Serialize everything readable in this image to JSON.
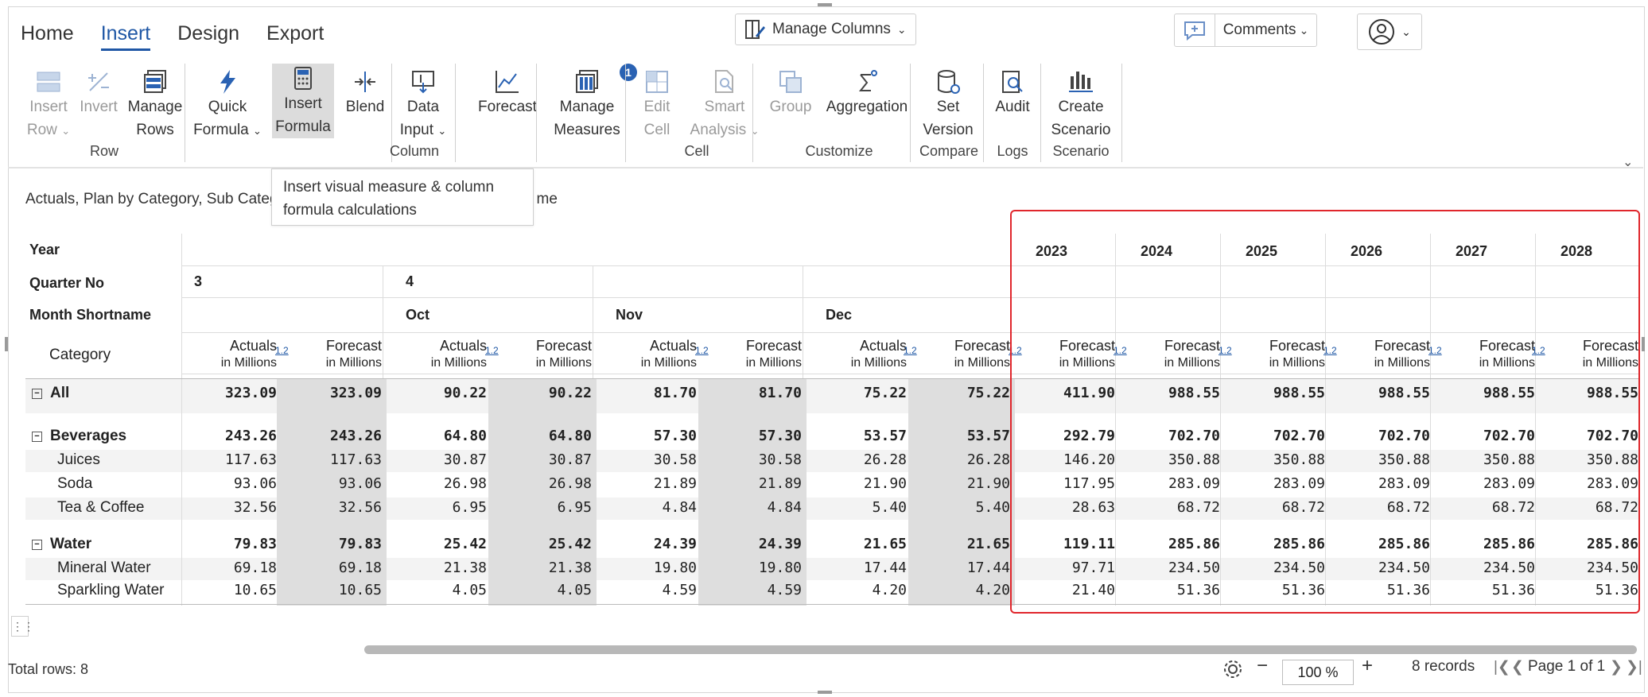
{
  "tabs": [
    {
      "label": "Home",
      "active": false
    },
    {
      "label": "Insert",
      "active": true
    },
    {
      "label": "Design",
      "active": false
    },
    {
      "label": "Export",
      "active": false
    }
  ],
  "manage_columns": {
    "label": "Manage Columns"
  },
  "comments": {
    "label": "Comments"
  },
  "ribbon": {
    "insert_row": [
      "Insert",
      "Row"
    ],
    "invert": "Invert",
    "manage_rows": [
      "Manage",
      "Rows"
    ],
    "quick_formula": [
      "Quick",
      "Formula"
    ],
    "insert_formula": [
      "Insert",
      "Formula"
    ],
    "blend": "Blend",
    "data_input": [
      "Data",
      "Input"
    ],
    "forecast": "Forecast",
    "manage_measures": [
      "Manage",
      "Measures"
    ],
    "manage_measures_badge": "1",
    "edit_cell": [
      "Edit",
      "Cell"
    ],
    "smart_analysis": [
      "Smart",
      "Analysis"
    ],
    "group": "Group",
    "aggregation": "Aggregation",
    "set_version": [
      "Set",
      "Version"
    ],
    "audit": "Audit",
    "create_scenario": [
      "Create",
      "Scenario"
    ],
    "groups": [
      "Row",
      "Column",
      "Cell",
      "Customize",
      "Compare",
      "Logs",
      "Scenario"
    ]
  },
  "tooltip": [
    "Insert visual measure & column",
    "formula calculations"
  ],
  "subtitle": {
    "left": "Actuals, Plan by Category, Sub Categ",
    "right": "me"
  },
  "grid": {
    "labels": {
      "year": "Year",
      "quarter": "Quarter No",
      "month": "Month Shortname",
      "category": "Category"
    },
    "quarter_values": [
      "3",
      "4"
    ],
    "months": [
      "Oct",
      "Nov",
      "Dec"
    ],
    "years": [
      "2023",
      "2024",
      "2025",
      "2026",
      "2027",
      "2028"
    ],
    "measure_actuals": "Actuals",
    "measure_forecast": "Forecast",
    "measure_unit": "in Millions",
    "badge": "1.2",
    "rows": [
      {
        "label": "All",
        "bold": true,
        "toggle": true,
        "indent": false,
        "values": [
          "323.09",
          "323.09",
          "90.22",
          "90.22",
          "81.70",
          "81.70",
          "75.22",
          "75.22",
          "411.90",
          "988.55",
          "988.55",
          "988.55",
          "988.55",
          "988.55"
        ]
      },
      {
        "label": "Beverages",
        "bold": true,
        "toggle": true,
        "indent": false,
        "values": [
          "243.26",
          "243.26",
          "64.80",
          "64.80",
          "57.30",
          "57.30",
          "53.57",
          "53.57",
          "292.79",
          "702.70",
          "702.70",
          "702.70",
          "702.70",
          "702.70"
        ]
      },
      {
        "label": "Juices",
        "bold": false,
        "toggle": false,
        "indent": true,
        "values": [
          "117.63",
          "117.63",
          "30.87",
          "30.87",
          "30.58",
          "30.58",
          "26.28",
          "26.28",
          "146.20",
          "350.88",
          "350.88",
          "350.88",
          "350.88",
          "350.88"
        ]
      },
      {
        "label": "Soda",
        "bold": false,
        "toggle": false,
        "indent": true,
        "values": [
          "93.06",
          "93.06",
          "26.98",
          "26.98",
          "21.89",
          "21.89",
          "21.90",
          "21.90",
          "117.95",
          "283.09",
          "283.09",
          "283.09",
          "283.09",
          "283.09"
        ]
      },
      {
        "label": "Tea & Coffee",
        "bold": false,
        "toggle": false,
        "indent": true,
        "values": [
          "32.56",
          "32.56",
          "6.95",
          "6.95",
          "4.84",
          "4.84",
          "5.40",
          "5.40",
          "28.63",
          "68.72",
          "68.72",
          "68.72",
          "68.72",
          "68.72"
        ]
      },
      {
        "label": "Water",
        "bold": true,
        "toggle": true,
        "indent": false,
        "values": [
          "79.83",
          "79.83",
          "25.42",
          "25.42",
          "24.39",
          "24.39",
          "21.65",
          "21.65",
          "119.11",
          "285.86",
          "285.86",
          "285.86",
          "285.86",
          "285.86"
        ]
      },
      {
        "label": "Mineral Water",
        "bold": false,
        "toggle": false,
        "indent": true,
        "values": [
          "69.18",
          "69.18",
          "21.38",
          "21.38",
          "19.80",
          "19.80",
          "17.44",
          "17.44",
          "97.71",
          "234.50",
          "234.50",
          "234.50",
          "234.50",
          "234.50"
        ]
      },
      {
        "label": "Sparkling Water",
        "bold": false,
        "toggle": false,
        "indent": true,
        "values": [
          "10.65",
          "10.65",
          "4.05",
          "4.05",
          "4.59",
          "4.59",
          "4.20",
          "4.20",
          "21.40",
          "51.36",
          "51.36",
          "51.36",
          "51.36",
          "51.36"
        ]
      }
    ]
  },
  "footer": {
    "total_rows": "Total rows: 8",
    "zoom": "100 %",
    "records": "8 records",
    "page": "Page 1 of 1"
  }
}
